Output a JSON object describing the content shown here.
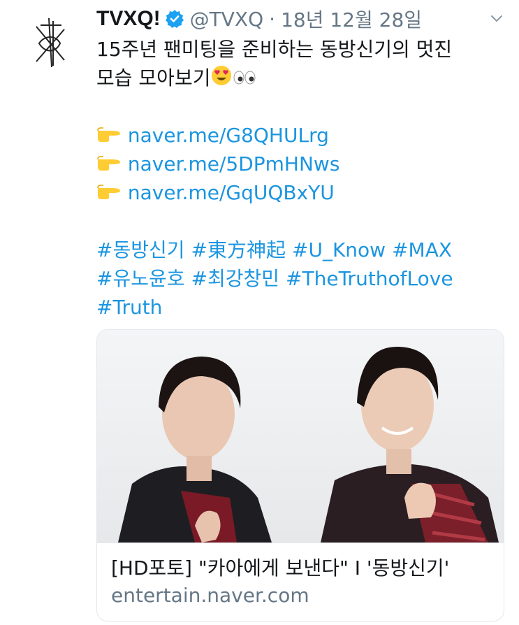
{
  "tweet": {
    "display_name": "TVXQ!",
    "handle": "@TVXQ",
    "separator": "·",
    "date": "18년 12월 28일",
    "text_line1": "15주년 팬미팅을 준비하는 동방신기의 멋진",
    "text_line2": "모습 모아보기",
    "links": [
      "naver.me/G8QHULrg",
      "naver.me/5DPmHNws",
      "naver.me/GqUQBxYU"
    ],
    "hashtags_line1": [
      "#동방신기",
      "#東方神起",
      "#U_Know",
      "#MAX"
    ],
    "hashtags_line2": [
      "#유노윤호",
      "#최강창민",
      "#TheTruthofLove"
    ],
    "hashtags_line3": [
      "#Truth"
    ]
  },
  "card": {
    "title": "[HD포토] \"카아에게 보낸다\" I '동방신기'",
    "domain": "entertain.naver.com"
  },
  "icons": {
    "avatar": "tvxq-logo",
    "verified": "verified-badge-icon",
    "menu": "chevron-down-icon",
    "pointing": "pointing-right-emoji",
    "heart_eyes": "heart-eyes-emoji",
    "eyes": "eyes-emoji"
  },
  "colors": {
    "link": "#1b95e0",
    "muted": "#657786",
    "verified": "#1da1f2"
  }
}
